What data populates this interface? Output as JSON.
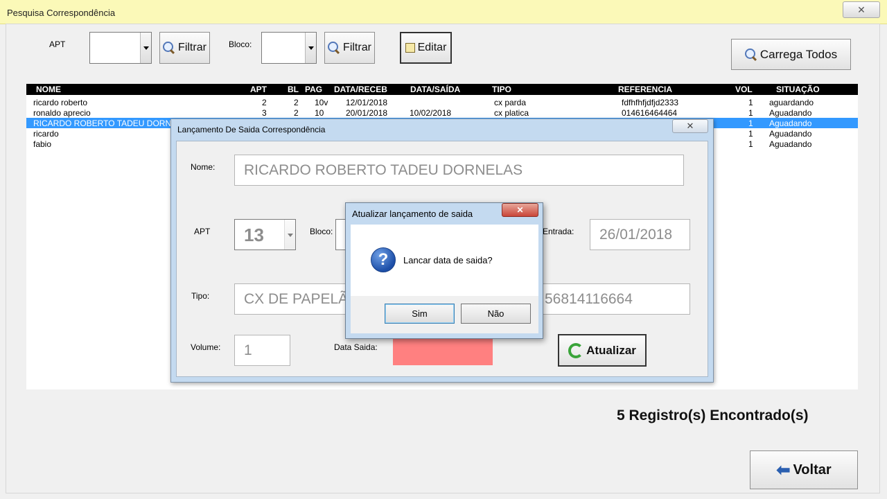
{
  "window": {
    "title": "Pesquisa Correspondência",
    "close_glyph": "✕"
  },
  "filters": {
    "apt_label": "APT",
    "apt_value": "",
    "bloco_label": "Bloco:",
    "bloco_value": "",
    "filtrar_label": "Filtrar",
    "editar_label": "Editar",
    "carrega_todos_label": "Carrega Todos"
  },
  "grid": {
    "columns": [
      "NOME",
      "APT",
      "BL",
      "PAG",
      "DATA/RECEB",
      "DATA/SAÍDA",
      "TIPO",
      "REFERENCIA",
      "VOL",
      "SITUAÇÃO"
    ],
    "rows": [
      {
        "nome": "ricardo roberto",
        "apt": "2",
        "bl": "2",
        "pag": "10v",
        "receb": "12/01/2018",
        "saida": "",
        "tipo": "cx parda",
        "ref": "fdfhfhfjdfjd2333",
        "vol": "1",
        "situacao": "aguardando"
      },
      {
        "nome": "ronaldo aprecio",
        "apt": "3",
        "bl": "2",
        "pag": "10",
        "receb": "20/01/2018",
        "saida": "10/02/2018",
        "tipo": "cx platica",
        "ref": "014616464464",
        "vol": "1",
        "situacao": "Aguadando"
      },
      {
        "nome": "RICARDO ROBERTO TADEU DORNE",
        "vol": "1",
        "situacao": "Aguadando",
        "selected": true
      },
      {
        "nome": "ricardo",
        "vol": "1",
        "situacao": "Aguadando"
      },
      {
        "nome": "fabio",
        "vol": "1",
        "situacao": "Aguadando"
      }
    ]
  },
  "count_text": "5 Registro(s) Encontrado(s)",
  "voltar_label": "Voltar",
  "launch_dialog": {
    "title": "Lançamento De Saida Correspondência",
    "close_glyph": "✕",
    "nome_label": "Nome:",
    "nome_value": "RICARDO ROBERTO TADEU DORNELAS",
    "apt_label": "APT",
    "apt_value": "13",
    "bloco_label": "Bloco:",
    "entrada_label": "Entrada:",
    "entrada_value": "26/01/2018",
    "tipo_label": "Tipo:",
    "tipo_value": "CX DE PAPELÃO",
    "ref_value": "56814116664",
    "volume_label": "Volume:",
    "volume_value": "1",
    "data_saida_label": "Data Saida:",
    "data_saida_color": "#ff8080",
    "atualizar_label": "Atualizar"
  },
  "confirm_dialog": {
    "title": "Atualizar lançamento de saida",
    "close_glyph": "✕",
    "message": "Lancar data de saida?",
    "icon_glyph": "?",
    "yes_label": "Sim",
    "no_label": "Não"
  }
}
